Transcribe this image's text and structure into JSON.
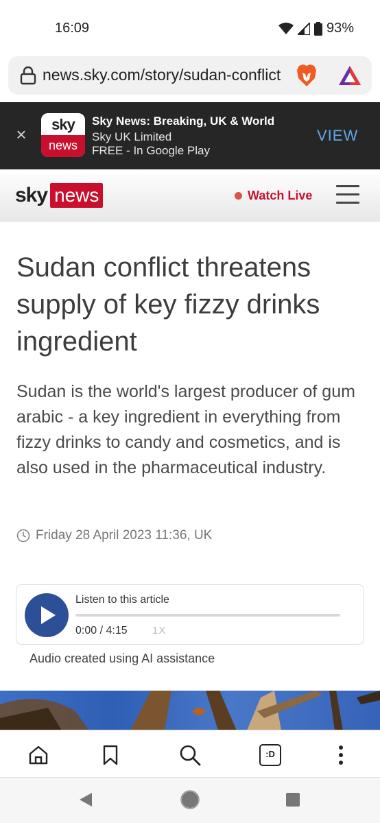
{
  "status_bar": {
    "time": "16:09",
    "battery": "93%"
  },
  "browser": {
    "url": "news.sky.com/story/sudan-conflict"
  },
  "app_banner": {
    "logo_top": "sky",
    "logo_bottom": "news",
    "title": "Sky News: Breaking, UK & World",
    "developer": "Sky UK Limited",
    "price": "FREE - In Google Play",
    "view_label": "VIEW",
    "close_glyph": "×"
  },
  "site_header": {
    "logo_sky": "sky",
    "logo_news": "news",
    "watch_live": "Watch Live"
  },
  "article": {
    "headline": "Sudan conflict threatens supply of key fizzy drinks ingredient",
    "standfirst": "Sudan is the world's largest producer of gum arabic - a key ingredient in everything from fizzy drinks to candy and cosmetics, and is also used in the pharmaceutical industry.",
    "date": "Friday 28 April 2023 11:36, UK"
  },
  "audio": {
    "label": "Listen to this article",
    "time": "0:00 / 4:15",
    "speed": "1X",
    "progress": 0,
    "note": "Audio created using AI assistance"
  },
  "toolbar": {
    "tabs_label": ":D"
  },
  "icons": {
    "lock": "lock-icon",
    "brave": "brave-lion-icon",
    "rewards": "brave-rewards-triangle-icon",
    "menu": "hamburger-menu-icon",
    "clock": "clock-icon",
    "play": "play-icon",
    "home": "home-icon",
    "bookmark": "bookmark-icon",
    "search": "search-icon",
    "tabs": "tabs-icon",
    "more": "more-vertical-icon"
  },
  "colors": {
    "sky_red": "#c8102e",
    "play_blue": "#2c4f98",
    "banner_bg": "#262626",
    "view_blue": "#5fa8e8"
  }
}
